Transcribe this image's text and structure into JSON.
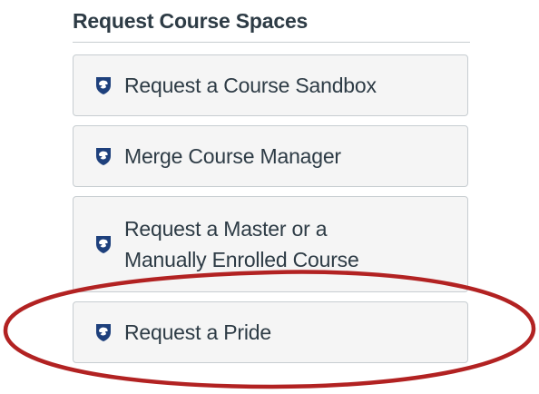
{
  "section": {
    "title": "Request Course Spaces"
  },
  "buttons": [
    {
      "label": "Request a Course Sandbox",
      "icon": "psu-shield-icon"
    },
    {
      "label": "Merge Course Manager",
      "icon": "psu-shield-icon"
    },
    {
      "label_lines": [
        "Request a Master or a",
        "Manually Enrolled Course"
      ],
      "icon": "psu-shield-icon"
    },
    {
      "label": "Request a Pride",
      "icon": "psu-shield-icon"
    }
  ],
  "colors": {
    "title_text": "#2d3b45",
    "button_bg": "#f5f5f5",
    "button_border": "#c7cdd1",
    "icon_blue": "#1e407c",
    "highlight_ring": "#b22222"
  }
}
